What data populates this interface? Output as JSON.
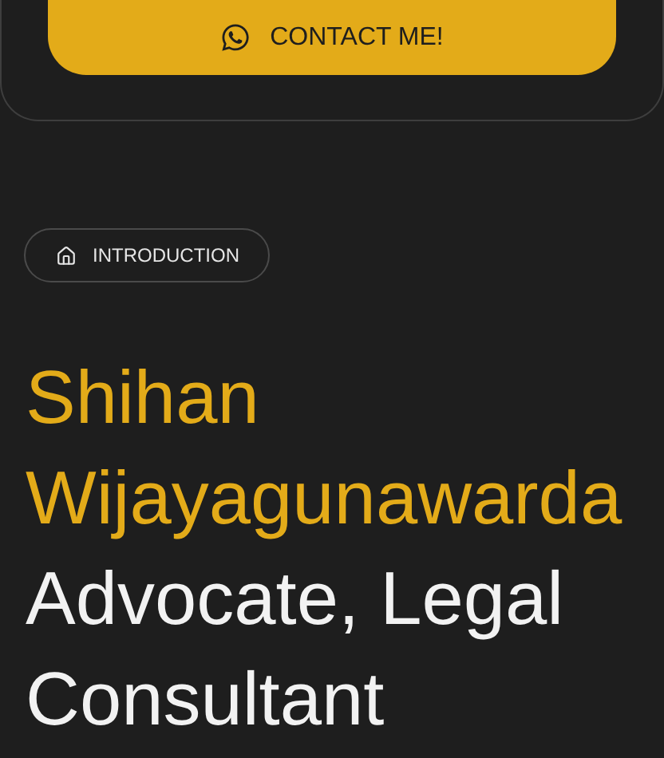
{
  "contact_button": {
    "label": "CONTACT ME!"
  },
  "section_tag": {
    "label": "INTRODUCTION"
  },
  "heading": {
    "name": "Shihan Wijayagunawarda",
    "title": "Advocate, Legal Consultant"
  }
}
